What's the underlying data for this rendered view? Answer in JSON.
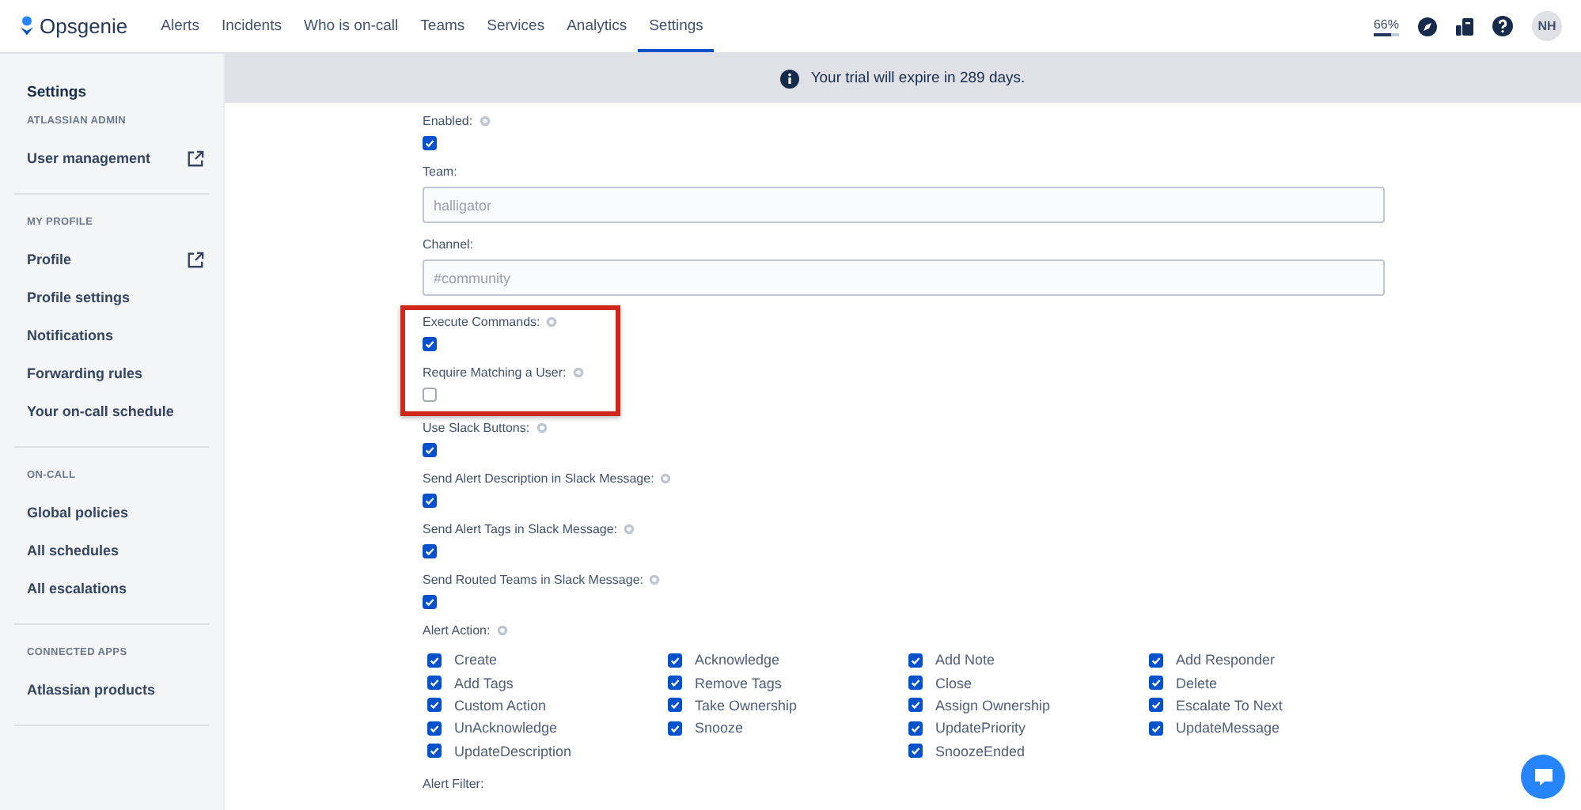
{
  "topbar": {
    "brand": "Opsgenie",
    "nav": [
      {
        "label": "Alerts",
        "selected": false
      },
      {
        "label": "Incidents",
        "selected": false
      },
      {
        "label": "Who is on-call",
        "selected": false
      },
      {
        "label": "Teams",
        "selected": false
      },
      {
        "label": "Services",
        "selected": false
      },
      {
        "label": "Analytics",
        "selected": false
      },
      {
        "label": "Settings",
        "selected": true
      }
    ],
    "progress": {
      "label": "66%",
      "level": 0.66
    },
    "avatar": "NH"
  },
  "sidebar": {
    "title": "Settings",
    "sections": [
      {
        "heading": "ATLASSIAN ADMIN",
        "items": [
          {
            "label": "User management",
            "external": true
          }
        ]
      },
      {
        "heading": "MY PROFILE",
        "items": [
          {
            "label": "Profile",
            "external": true
          },
          {
            "label": "Profile settings",
            "external": false
          },
          {
            "label": "Notifications",
            "external": false
          },
          {
            "label": "Forwarding rules",
            "external": false
          },
          {
            "label": "Your on-call schedule",
            "external": false
          }
        ]
      },
      {
        "heading": "ON-CALL",
        "items": [
          {
            "label": "Global policies",
            "external": false
          },
          {
            "label": "All schedules",
            "external": false
          },
          {
            "label": "All escalations",
            "external": false
          }
        ]
      },
      {
        "heading": "CONNECTED APPS",
        "items": [
          {
            "label": "Atlassian products",
            "external": false
          }
        ]
      }
    ]
  },
  "banner": {
    "text": "Your trial will expire in 289 days."
  },
  "form": {
    "fields": [
      {
        "kind": "checkbox",
        "label": "Enabled:",
        "checked": true,
        "highlighted": false
      },
      {
        "kind": "text",
        "label": "Team:",
        "placeholder": "halligator",
        "highlighted": false
      },
      {
        "kind": "text",
        "label": "Channel:",
        "placeholder": "#community",
        "highlighted": false
      },
      {
        "kind": "checkbox",
        "label": "Execute Commands:",
        "checked": true,
        "highlighted": true
      },
      {
        "kind": "checkbox",
        "label": "Require Matching a User:",
        "checked": false,
        "highlighted": true
      },
      {
        "kind": "checkbox",
        "label": "Use Slack Buttons:",
        "checked": true,
        "highlighted": false
      },
      {
        "kind": "checkbox",
        "label": "Send Alert Description in Slack Message:",
        "checked": true,
        "highlighted": false
      },
      {
        "kind": "checkbox",
        "label": "Send Alert Tags in Slack Message:",
        "checked": true,
        "highlighted": false
      },
      {
        "kind": "checkbox",
        "label": "Send Routed Teams in Slack Message:",
        "checked": true,
        "highlighted": false
      }
    ],
    "alert_action": {
      "label": "Alert Action:",
      "columns": [
        [
          {
            "label": "Create",
            "checked": true
          },
          {
            "label": "Add Tags",
            "checked": true
          },
          {
            "label": "Custom Action",
            "checked": true
          },
          {
            "label": "UnAcknowledge",
            "checked": true
          },
          {
            "label": "UpdateDescription",
            "checked": true
          }
        ],
        [
          {
            "label": "Acknowledge",
            "checked": true
          },
          {
            "label": "Remove Tags",
            "checked": true
          },
          {
            "label": "Take Ownership",
            "checked": true
          },
          {
            "label": "Snooze",
            "checked": true
          }
        ],
        [
          {
            "label": "Add Note",
            "checked": true
          },
          {
            "label": "Close",
            "checked": true
          },
          {
            "label": "Assign Ownership",
            "checked": true
          },
          {
            "label": "UpdatePriority",
            "checked": true
          },
          {
            "label": "SnoozeEnded",
            "checked": true
          }
        ],
        [
          {
            "label": "Add Responder",
            "checked": true
          },
          {
            "label": "Delete",
            "checked": true
          },
          {
            "label": "Escalate To Next",
            "checked": true
          },
          {
            "label": "UpdateMessage",
            "checked": true
          }
        ]
      ]
    },
    "alert_filter": {
      "label": "Alert Filter:"
    }
  }
}
